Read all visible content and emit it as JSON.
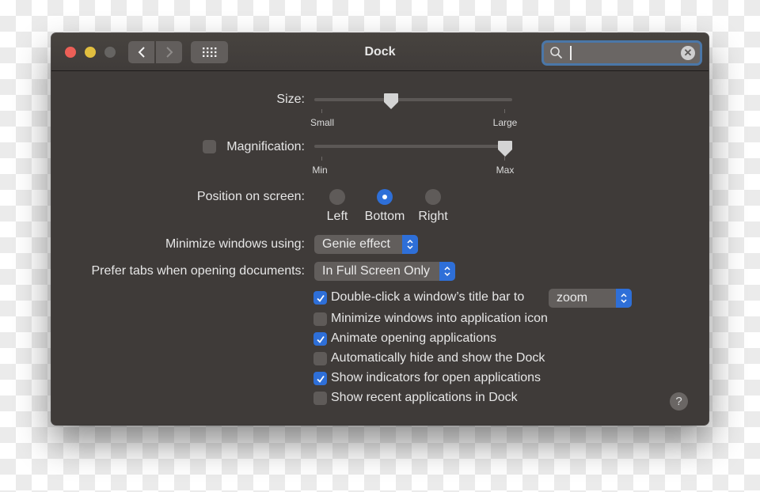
{
  "window": {
    "title": "Dock"
  },
  "toolbar": {
    "back_icon": "chevron-left",
    "forward_icon": "chevron-right",
    "grid_icon": "show-all-grid",
    "search": {
      "value": "",
      "placeholder": ""
    }
  },
  "size": {
    "label": "Size:",
    "min_label": "Small",
    "max_label": "Large",
    "value_fraction": 0.38
  },
  "magnification": {
    "label": "Magnification:",
    "checked": false,
    "min_label": "Min",
    "max_label": "Max",
    "value_fraction": 1.0
  },
  "position": {
    "label": "Position on screen:",
    "options": [
      "Left",
      "Bottom",
      "Right"
    ],
    "selected": "Bottom"
  },
  "minimize": {
    "label": "Minimize windows using:",
    "value": "Genie effect"
  },
  "prefer_tabs": {
    "label": "Prefer tabs when opening documents:",
    "value": "In Full Screen Only"
  },
  "checkboxes": [
    {
      "label": "Double-click a window’s title bar to",
      "checked": true,
      "popup_value": "zoom"
    },
    {
      "label": "Minimize windows into application icon",
      "checked": false
    },
    {
      "label": "Animate opening applications",
      "checked": true
    },
    {
      "label": "Automatically hide and show the Dock",
      "checked": false
    },
    {
      "label": "Show indicators for open applications",
      "checked": true
    },
    {
      "label": "Show recent applications in Dock",
      "checked": false
    }
  ],
  "help": {
    "label": "?"
  },
  "colors": {
    "accent": "#2e6fd8",
    "window_bg": "#3f3b39",
    "search_focus": "#4b77a8"
  }
}
